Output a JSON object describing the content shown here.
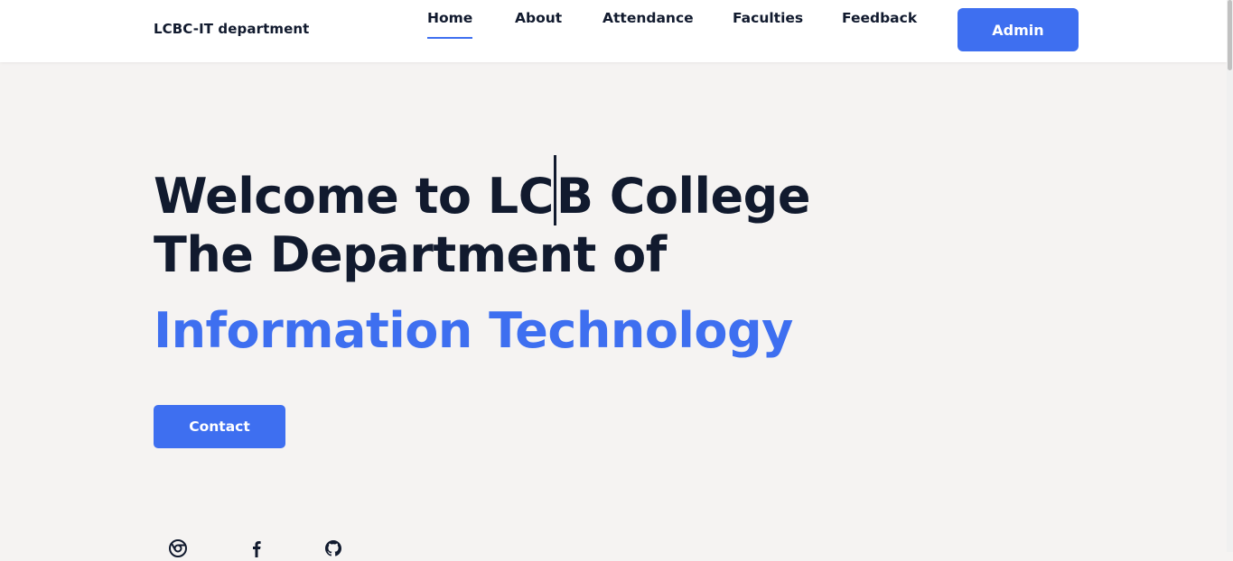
{
  "header": {
    "brand": "LCBC-IT department",
    "nav": [
      {
        "label": "Home",
        "active": true
      },
      {
        "label": "About",
        "active": false
      },
      {
        "label": "Attendance",
        "active": false
      },
      {
        "label": "Faculties",
        "active": false
      },
      {
        "label": "Feedback",
        "active": false
      }
    ],
    "admin_label": "Admin"
  },
  "hero": {
    "line1_before_cursor": "Welcome to LC",
    "line1_after_cursor": "B College",
    "line2": "The Department of",
    "line3": "Information Technology",
    "contact_label": "Contact"
  },
  "social_icons": [
    "chrome-icon",
    "facebook-icon",
    "github-icon"
  ],
  "colors": {
    "accent": "#3e6ff0",
    "text_dark": "#111a2e",
    "page_bg": "#f5f3f2",
    "header_bg": "#ffffff"
  }
}
